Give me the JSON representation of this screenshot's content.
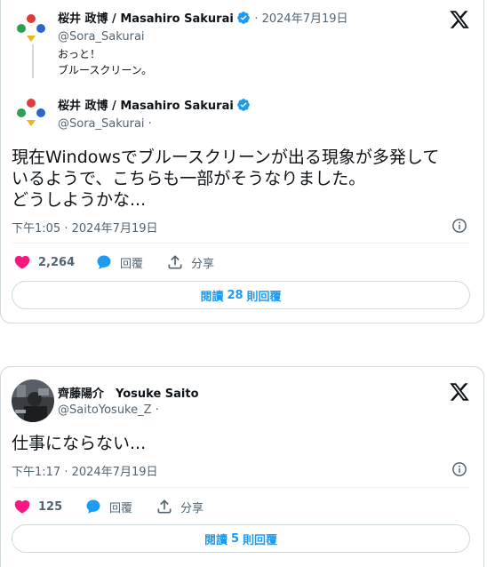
{
  "tweet1": {
    "parent": {
      "name": "桜井 政博 / Masahiro Sakurai",
      "handle": "@Sora_Sakurai",
      "date": "· 2024年7月19日",
      "text_line1": "おっと！",
      "text_line2": "ブルースクリーン。"
    },
    "main": {
      "name": "桜井 政博 / Masahiro Sakurai",
      "handle": "@Sora_Sakurai",
      "text_line1": "現在Windowsでブルースクリーンが出る現象が多発して",
      "text_line2": "いるようで、こちらも一部がそうなりました。",
      "text_line3": "どうしようかな...",
      "timestamp": "下午1:05 · 2024年7月19日",
      "likes": "2,264",
      "reply_label": "回覆",
      "share_label": "分享",
      "read_replies": {
        "prefix": "閱讀",
        "count": "28",
        "suffix": "則回覆"
      }
    }
  },
  "tweet2": {
    "name": "齊藤陽介　Yosuke Saito",
    "handle": "@SaitoYosuke_Z",
    "text_line1": "仕事にならない...",
    "timestamp": "下午1:17 · 2024年7月19日",
    "likes": "125",
    "reply_label": "回覆",
    "share_label": "分享",
    "read_replies": {
      "prefix": "閱讀",
      "count": "5",
      "suffix": "則回覆"
    }
  },
  "colors": {
    "like_pink": "#f91880",
    "accent_blue": "#1d9bf0",
    "muted_gray": "#536471",
    "border": "#cfd9de"
  },
  "icons": [
    "smash-logo-avatar-icon",
    "verified-badge-icon",
    "x-logo-icon",
    "info-icon",
    "heart-icon",
    "reply-bubble-icon",
    "share-icon"
  ]
}
